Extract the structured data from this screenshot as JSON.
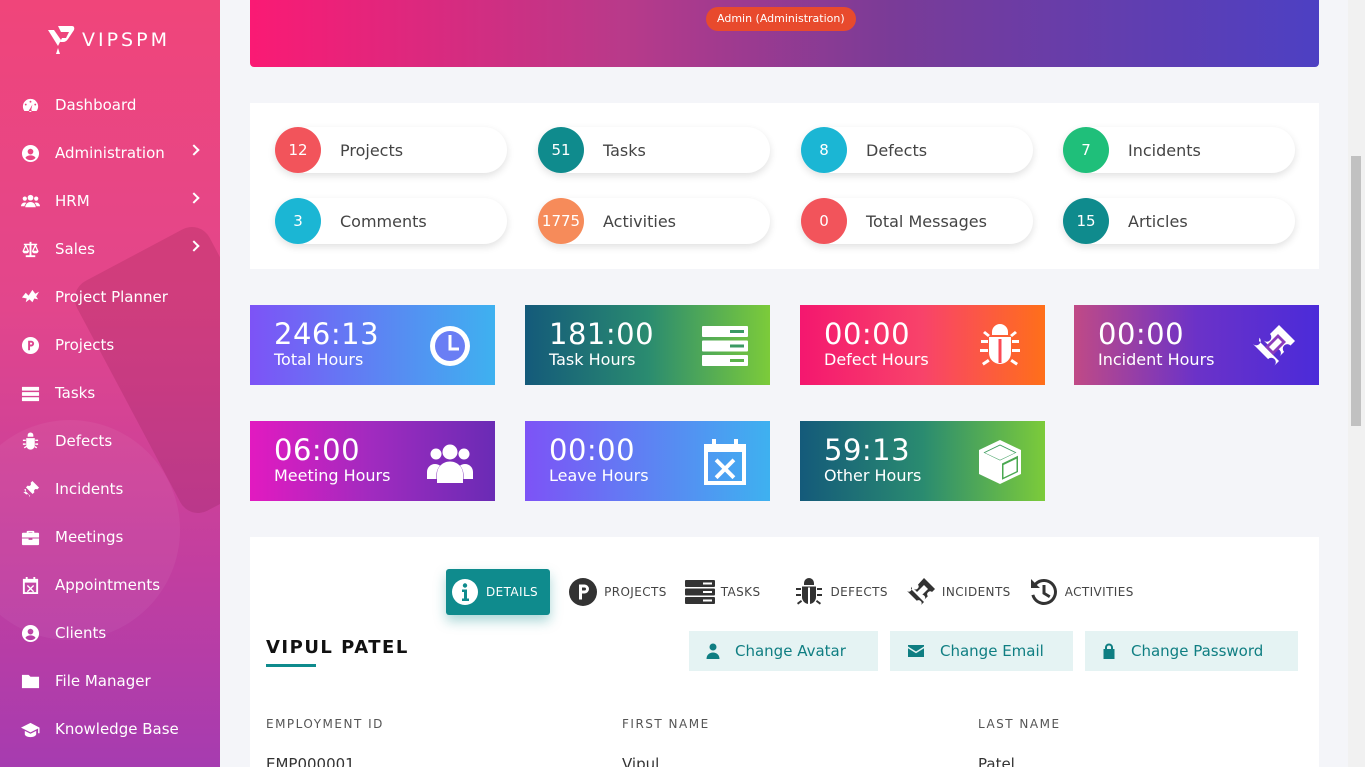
{
  "app": {
    "logo_text": "VIPSPM"
  },
  "sidebar": {
    "items": [
      {
        "label": "Dashboard",
        "icon": "dashboard-icon",
        "has_submenu": false
      },
      {
        "label": "Administration",
        "icon": "user-circle-icon",
        "has_submenu": true
      },
      {
        "label": "HRM",
        "icon": "users-icon",
        "has_submenu": true
      },
      {
        "label": "Sales",
        "icon": "balance-scale-icon",
        "has_submenu": true
      },
      {
        "label": "Project Planner",
        "icon": "planner-icon",
        "has_submenu": false
      },
      {
        "label": "Projects",
        "icon": "p-circle-icon",
        "has_submenu": false
      },
      {
        "label": "Tasks",
        "icon": "tasks-icon",
        "has_submenu": false
      },
      {
        "label": "Defects",
        "icon": "bug-icon",
        "has_submenu": false
      },
      {
        "label": "Incidents",
        "icon": "ticket-icon",
        "has_submenu": false
      },
      {
        "label": "Meetings",
        "icon": "briefcase-icon",
        "has_submenu": false
      },
      {
        "label": "Appointments",
        "icon": "calendar-x-icon",
        "has_submenu": false
      },
      {
        "label": "Clients",
        "icon": "user-circle-icon",
        "has_submenu": false
      },
      {
        "label": "File Manager",
        "icon": "folder-icon",
        "has_submenu": false
      },
      {
        "label": "Knowledge Base",
        "icon": "graduation-cap-icon",
        "has_submenu": false
      }
    ]
  },
  "banner": {
    "role_badge": "Admin (Administration)"
  },
  "stats": [
    {
      "count": "12",
      "label": "Projects",
      "color": "#f2545b"
    },
    {
      "count": "51",
      "label": "Tasks",
      "color": "#0f8b8d"
    },
    {
      "count": "8",
      "label": "Defects",
      "color": "#1bb6d4"
    },
    {
      "count": "7",
      "label": "Incidents",
      "color": "#1fbf7a"
    },
    {
      "count": "3",
      "label": "Comments",
      "color": "#1bb6d4"
    },
    {
      "count": "1775",
      "label": "Activities",
      "color": "#f68b5a"
    },
    {
      "count": "0",
      "label": "Total Messages",
      "color": "#f2545b"
    },
    {
      "count": "15",
      "label": "Articles",
      "color": "#0f8b8d"
    }
  ],
  "hours": [
    {
      "value": "246:13",
      "label": "Total Hours",
      "icon": "clock-icon"
    },
    {
      "value": "181:00",
      "label": "Task Hours",
      "icon": "tasks-icon"
    },
    {
      "value": "00:00",
      "label": "Defect Hours",
      "icon": "bug-icon"
    },
    {
      "value": "00:00",
      "label": "Incident Hours",
      "icon": "ticket-icon"
    },
    {
      "value": "06:00",
      "label": "Meeting Hours",
      "icon": "users-icon"
    },
    {
      "value": "00:00",
      "label": "Leave Hours",
      "icon": "calendar-x-icon"
    },
    {
      "value": "59:13",
      "label": "Other Hours",
      "icon": "cube-icon"
    }
  ],
  "profile": {
    "tabs": [
      {
        "label": "DETAILS",
        "icon": "info-circle-icon",
        "active": true
      },
      {
        "label": "PROJECTS",
        "icon": "p-circle-icon",
        "active": false
      },
      {
        "label": "TASKS",
        "icon": "tasks-icon",
        "active": false
      },
      {
        "label": "DEFECTS",
        "icon": "bug-icon",
        "active": false
      },
      {
        "label": "INCIDENTS",
        "icon": "ticket-icon",
        "active": false
      },
      {
        "label": "ACTIVITIES",
        "icon": "history-icon",
        "active": false
      }
    ],
    "name": "VIPUL PATEL",
    "buttons": [
      {
        "label": "Change Avatar",
        "icon": "user-icon"
      },
      {
        "label": "Change Email",
        "icon": "envelope-icon"
      },
      {
        "label": "Change Password",
        "icon": "lock-icon"
      }
    ],
    "fields": [
      {
        "label": "EMPLOYMENT ID",
        "value": "EMP000001"
      },
      {
        "label": "FIRST NAME",
        "value": "Vipul"
      },
      {
        "label": "LAST NAME",
        "value": "Patel"
      }
    ]
  }
}
